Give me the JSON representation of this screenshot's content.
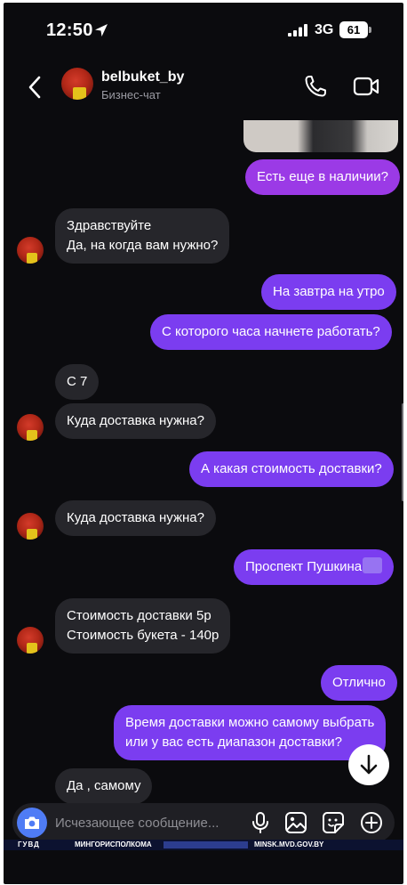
{
  "status_bar": {
    "time": "12:50",
    "network": "3G",
    "battery": "61"
  },
  "header": {
    "name": "belbuket_by",
    "subtitle": "Бизнес-чат"
  },
  "messages": [
    {
      "side": "out",
      "text": "Есть еще в наличии?"
    },
    {
      "side": "in",
      "text": "Здравствуйте\nДа, на когда вам нужно?"
    },
    {
      "side": "out",
      "text": "На завтра на утро"
    },
    {
      "side": "out",
      "text": "С которого часа начнете работать?"
    },
    {
      "side": "in",
      "text": "С 7"
    },
    {
      "side": "in",
      "text": "Куда доставка нужна?"
    },
    {
      "side": "out",
      "text": "А какая стоимость доставки?"
    },
    {
      "side": "in",
      "text": "Куда доставка нужна?"
    },
    {
      "side": "out",
      "text": "Проспект Пушкина"
    },
    {
      "side": "in",
      "text": "Стоимость доставки 5р\nСтоимость букета - 140р"
    },
    {
      "side": "out",
      "text": "Отлично"
    },
    {
      "side": "out",
      "text": "Время доставки можно самому выбрать\nили у вас есть диапазон доставки?"
    },
    {
      "side": "in",
      "text": "Да , самому"
    }
  ],
  "composer": {
    "placeholder": "Исчезающее сообщение..."
  },
  "watermark": {
    "left": "ГУВД",
    "middle": "МИНГОРИСПОЛКОМА",
    "right": "MINSK.MVD.GOV.BY"
  },
  "colors": {
    "background": "#0b0b0e",
    "outgoing": "#7b3df0",
    "incoming": "#26262b",
    "camera": "#4f7cf5"
  }
}
